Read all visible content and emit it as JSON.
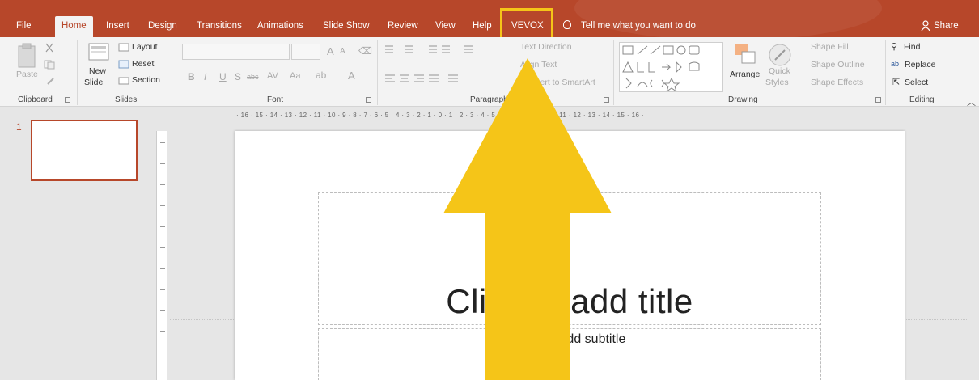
{
  "tabs": [
    {
      "label": "File"
    },
    {
      "label": "Home"
    },
    {
      "label": "Insert"
    },
    {
      "label": "Design"
    },
    {
      "label": "Transitions"
    },
    {
      "label": "Animations"
    },
    {
      "label": "Slide Show"
    },
    {
      "label": "Review"
    },
    {
      "label": "View"
    },
    {
      "label": "Help"
    },
    {
      "label": "VEVOX"
    }
  ],
  "active_tab": "Home",
  "highlighted_tab": "VEVOX",
  "tell_me": "Tell me what you want to do",
  "share": "Share",
  "ribbon": {
    "clipboard": {
      "paste": "Paste",
      "group": "Clipboard"
    },
    "slides": {
      "new_slide": "New",
      "new_slide_2": "Slide",
      "layout": "Layout",
      "reset": "Reset",
      "section": "Section",
      "group": "Slides"
    },
    "font": {
      "group": "Font",
      "bold": "B",
      "italic": "I",
      "underline": "U",
      "shadow": "S",
      "strike": "abc",
      "spacing": "AV",
      "case": "Aa",
      "grow": "A",
      "shrink": "A",
      "color": "A"
    },
    "paragraph": {
      "group": "Paragraph",
      "text_direction": "Text Direction",
      "align_text": "Align Text",
      "smartart": "Convert to SmartArt"
    },
    "drawing": {
      "group": "Drawing",
      "arrange": "Arrange",
      "quick_styles": "Quick",
      "quick_styles_2": "Styles",
      "shape_fill": "Shape Fill",
      "shape_outline": "Shape Outline",
      "shape_effects": "Shape Effects"
    },
    "editing": {
      "group": "Editing",
      "find": "Find",
      "replace": "Replace",
      "select": "Select"
    }
  },
  "ruler_h": "· 16 · 15 · 14 · 13 · 12 · 11 · 10 · 9 · 8 · 7 · 6 · 5 · 4 · 3 · 2 · 1 · 0 · 1 · 2 · 3 · 4 · 5 · 6 · 7 · 8 · 9 · 10 · 11 · 12 · 13 · 14 · 15 · 16 ·",
  "thumbnail": {
    "number": "1"
  },
  "slide": {
    "title_placeholder": "Click to add title",
    "subtitle_placeholder": "Click to add subtitle"
  },
  "colors": {
    "accent": "#b7472a",
    "arrow": "#f5c518"
  }
}
